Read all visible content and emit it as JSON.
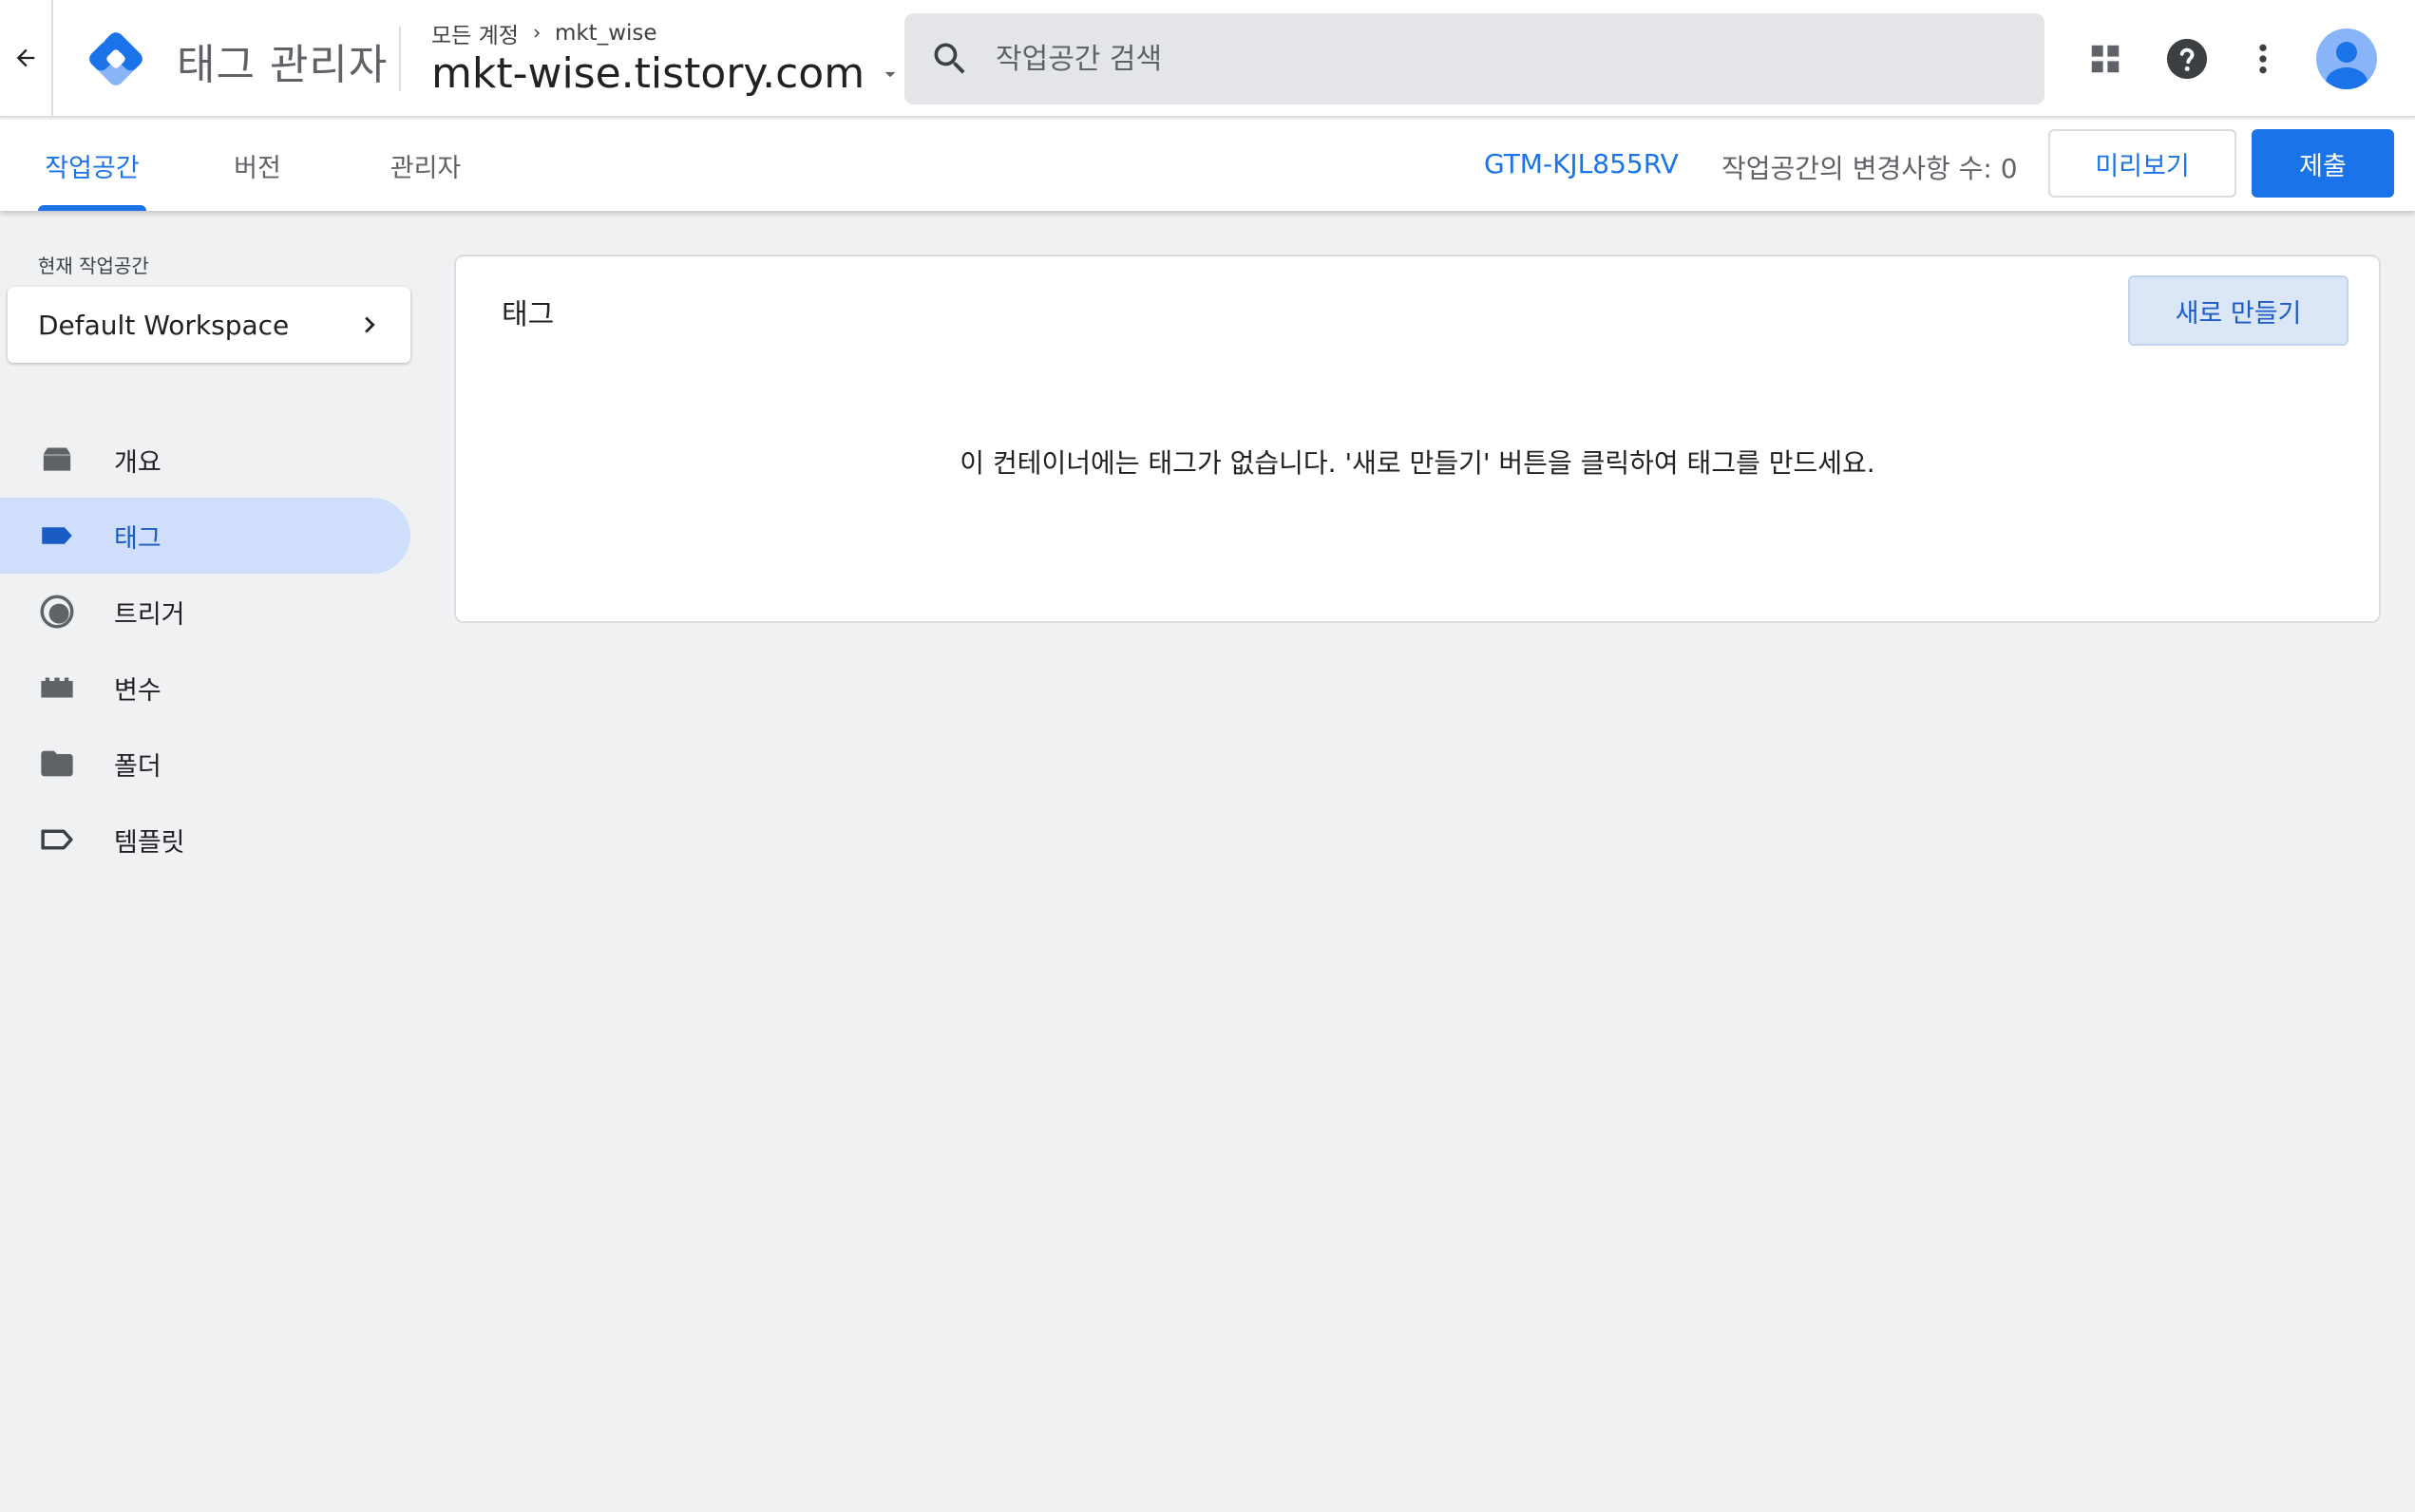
{
  "header": {
    "back_icon": "arrow-left-icon",
    "app_title": "태그 관리자",
    "breadcrumb_root": "모든 계정",
    "breadcrumb_account": "mkt_wise",
    "container_name": "mkt-wise.tistory.com",
    "search_placeholder": "작업공간 검색",
    "icons": [
      "apps-grid-icon",
      "help-icon",
      "more-vert-icon",
      "avatar"
    ]
  },
  "tabs": {
    "items": [
      {
        "label": "작업공간",
        "active": true
      },
      {
        "label": "버전",
        "active": false
      },
      {
        "label": "관리자",
        "active": false
      }
    ],
    "container_id": "GTM-KJL855RV",
    "changes_text": "작업공간의 변경사항 수: 0",
    "preview_label": "미리보기",
    "submit_label": "제출"
  },
  "sidebar": {
    "workspace_label": "현재 작업공간",
    "workspace_name": "Default Workspace",
    "items": [
      {
        "label": "개요",
        "icon": "overview-icon",
        "active": false
      },
      {
        "label": "태그",
        "icon": "tag-icon",
        "active": true
      },
      {
        "label": "트리거",
        "icon": "trigger-icon",
        "active": false
      },
      {
        "label": "변수",
        "icon": "variable-icon",
        "active": false
      },
      {
        "label": "폴더",
        "icon": "folder-icon",
        "active": false
      },
      {
        "label": "템플릿",
        "icon": "template-icon",
        "active": false
      }
    ]
  },
  "main": {
    "card_title": "태그",
    "new_button": "새로 만들기",
    "empty_message": "이 컨테이너에는 태그가 없습니다. '새로 만들기' 버튼을 클릭하여 태그를 만드세요."
  },
  "colors": {
    "accent": "#1a73e8",
    "active_nav_bg": "#cfdffb",
    "page_bg": "#f0f1f3"
  }
}
